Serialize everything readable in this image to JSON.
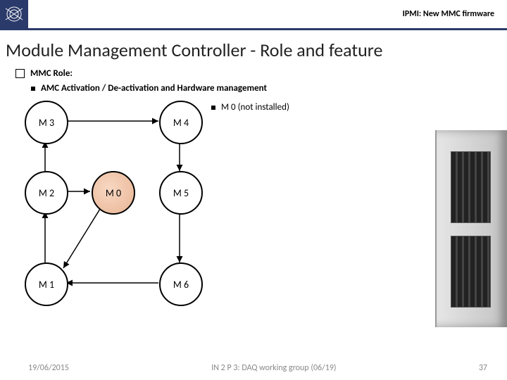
{
  "header": {
    "topic": "IPMI: New MMC firmware"
  },
  "title": "Module Management Controller - Role and feature",
  "bullets": {
    "main": "MMC Role:",
    "sub": "AMC Activation / De-activation and Hardware management"
  },
  "diagram": {
    "nodes": {
      "m0": "M 0",
      "m1": "M 1",
      "m2": "M 2",
      "m3": "M 3",
      "m4": "M 4",
      "m5": "M 5",
      "m6": "M 6"
    },
    "annotation": "M 0 (not installed)"
  },
  "footer": {
    "date": "19/06/2015",
    "group": "IN 2 P 3: DAQ working group (06/19)",
    "page": "37"
  }
}
